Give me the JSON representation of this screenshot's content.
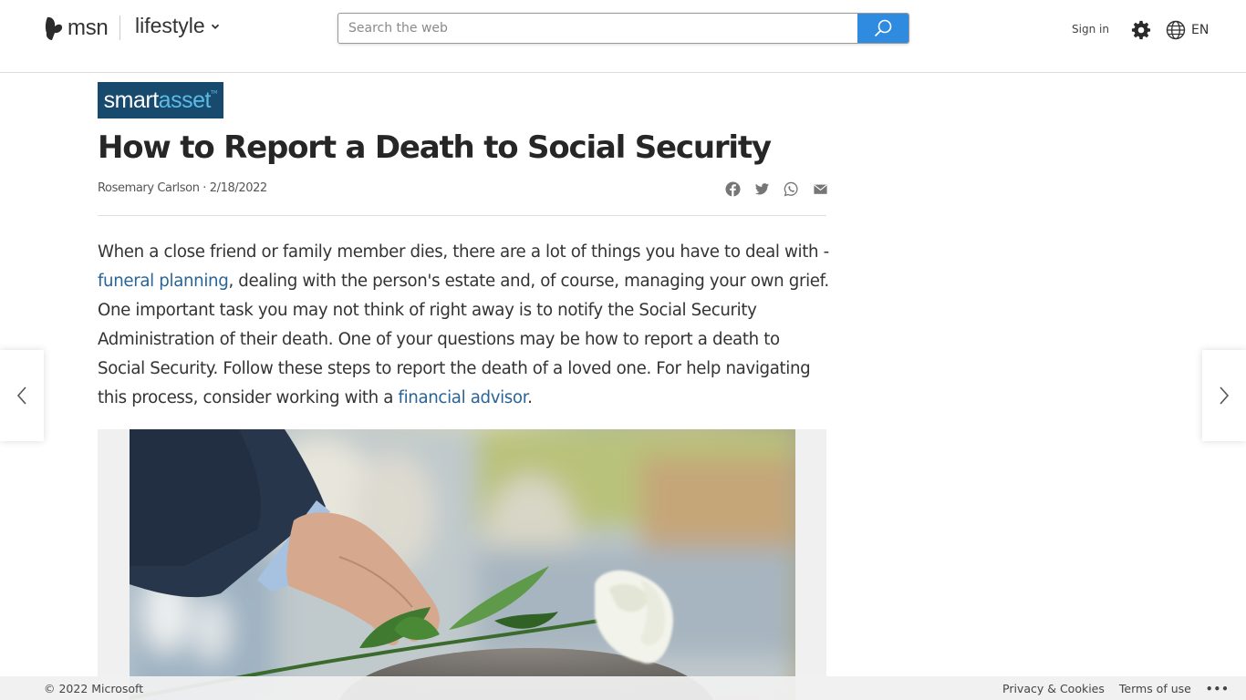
{
  "header": {
    "logo_text": "msn",
    "section_label": "lifestyle",
    "search": {
      "placeholder": "Search the web",
      "value": ""
    },
    "sign_in": "Sign in",
    "language": "EN",
    "icons": {
      "logo": "msn-butterfly-icon",
      "section": "chevron-down-icon",
      "search": "search-icon",
      "settings": "gear-icon",
      "language": "globe-icon"
    }
  },
  "article": {
    "source": {
      "name_part1": "smart",
      "name_part2": "asset",
      "trademark": "TM"
    },
    "title": "How to Report a Death to Social Security",
    "author": "Rosemary Carlson",
    "separator": " · ",
    "date": "2/18/2022",
    "share": [
      {
        "name": "facebook",
        "icon": "facebook-icon"
      },
      {
        "name": "twitter",
        "icon": "twitter-icon"
      },
      {
        "name": "whatsapp",
        "icon": "whatsapp-icon"
      },
      {
        "name": "email",
        "icon": "mail-icon"
      }
    ],
    "paragraph": {
      "part1": "When a close friend or family member dies, there are a lot of things you have to deal with - ",
      "link1": "funeral planning",
      "part2": ", dealing with the person's estate and, of course, managing your own grief. One important task you may not think of right away is to notify the Social Security Administration of their death. One of your questions may be how to report a death to Social Security. Follow these steps to report the death of a loved one. For help navigating this process, consider working with a ",
      "link2": "financial advisor",
      "part3": "."
    },
    "image": {
      "alt": "Hand in suit sleeve placing a white rose on a gravestone"
    }
  },
  "navigation": {
    "prev_icon": "chevron-left-icon",
    "next_icon": "chevron-right-icon"
  },
  "footer": {
    "copyright": "© 2022 Microsoft",
    "links": [
      "Privacy & Cookies",
      "Terms of use"
    ],
    "more": "•••"
  },
  "colors": {
    "search_button": "#2f8be0",
    "brand_bg": "#184a6e",
    "brand_accent": "#5bbbe6",
    "link": "#2a6496"
  }
}
